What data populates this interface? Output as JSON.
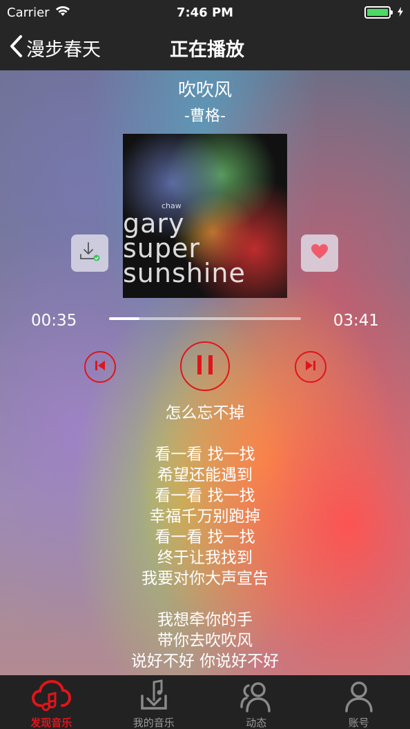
{
  "status_bar": {
    "carrier": "Carrier",
    "time": "7:46 PM",
    "battery_level": 1.0,
    "battery_color": "#4cd964"
  },
  "nav": {
    "back_label": "漫步春天",
    "title": "正在播放"
  },
  "song": {
    "title": "吹吹风",
    "artist": "-曹格-"
  },
  "album": {
    "small_text": "chaw",
    "lines": [
      "gary",
      "super",
      "sunshine"
    ]
  },
  "player": {
    "current_time": "00:35",
    "total_time": "03:41",
    "progress": 0.16,
    "accent_color": "#e0151b",
    "icons": {
      "download": "download-icon",
      "like": "heart-icon",
      "prev": "previous-icon",
      "play_pause": "pause-icon",
      "next": "next-icon"
    }
  },
  "lyrics": [
    "怎么忘不掉",
    "",
    "看一看 找一找",
    "希望还能遇到",
    "看一看 找一找",
    "幸福千万别跑掉",
    "看一看 找一找",
    "终于让我找到",
    "我要对你大声宣告",
    "",
    "我想牵你的手",
    "带你去吹吹风",
    "说好不好 你说好不好"
  ],
  "tabs": [
    {
      "label": "发现音乐",
      "icon": "cloud-music-icon",
      "active": true
    },
    {
      "label": "我的音乐",
      "icon": "music-download-icon",
      "active": false
    },
    {
      "label": "动态",
      "icon": "friends-icon",
      "active": false
    },
    {
      "label": "账号",
      "icon": "account-icon",
      "active": false
    }
  ]
}
